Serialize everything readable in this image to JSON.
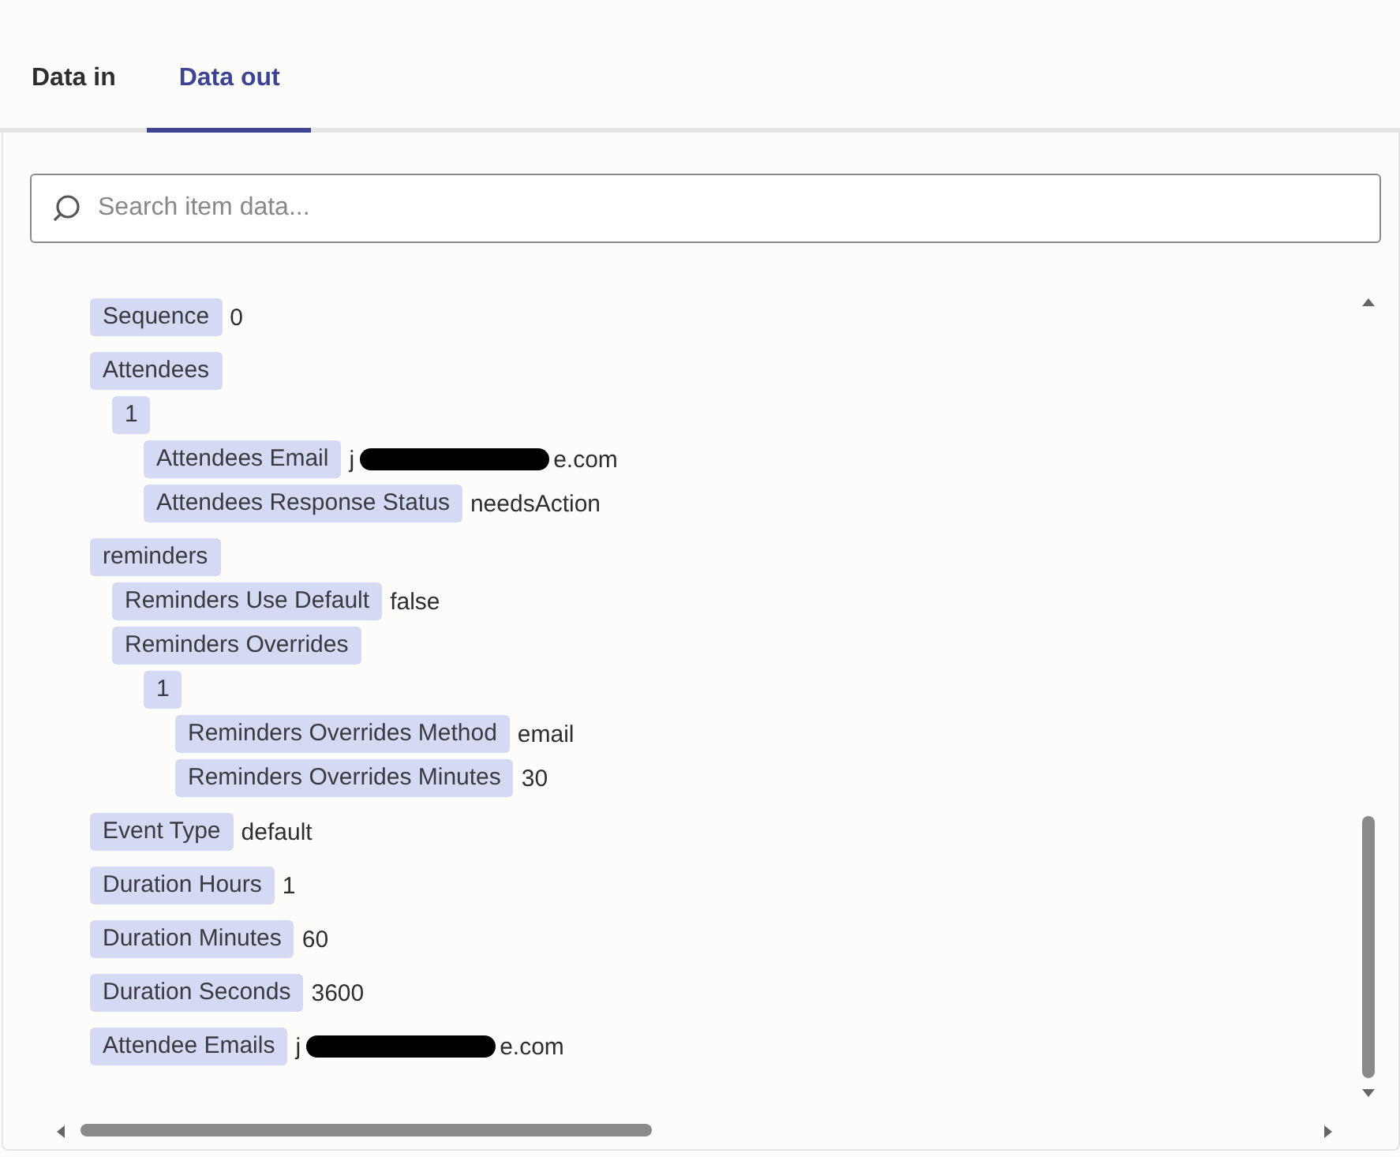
{
  "tabs": [
    {
      "label": "Data in",
      "selected": false
    },
    {
      "label": "Data out",
      "selected": true
    }
  ],
  "search": {
    "placeholder": "Search item data..."
  },
  "tree": [
    {
      "label": "Sequence",
      "value": "0"
    },
    {
      "label": "Attendees",
      "children": [
        {
          "label": "1",
          "children": [
            {
              "label": "Attendees Email",
              "value": "j",
              "redacted": true,
              "value_after": "e.com"
            },
            {
              "label": "Attendees Response Status",
              "value": "needsAction"
            }
          ]
        }
      ]
    },
    {
      "label": "reminders",
      "children": [
        {
          "label": "Reminders Use Default",
          "value": "false"
        },
        {
          "label": "Reminders Overrides",
          "children": [
            {
              "label": "1",
              "children": [
                {
                  "label": "Reminders Overrides Method",
                  "value": "email"
                },
                {
                  "label": "Reminders Overrides Minutes",
                  "value": "30"
                }
              ]
            }
          ]
        }
      ]
    },
    {
      "label": "Event Type",
      "value": "default"
    },
    {
      "label": "Duration Hours",
      "value": "1"
    },
    {
      "label": "Duration Minutes",
      "value": "60"
    },
    {
      "label": "Duration Seconds",
      "value": "3600"
    },
    {
      "label": "Attendee Emails",
      "value": "j",
      "redacted": true,
      "value_after": "e.com"
    }
  ]
}
